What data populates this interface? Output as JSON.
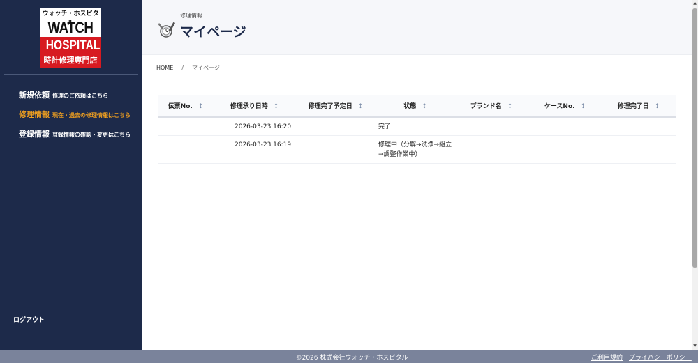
{
  "brand": {
    "logo_top": "ウォッチ・ホスピタル",
    "logo_watch": "WATCH",
    "logo_hospital": "HOSPITAL",
    "logo_bottom": "時計修理専門店"
  },
  "sidebar": {
    "items": [
      {
        "label": "新規依頼",
        "sub": "修理のご依頼はこちら",
        "active": false
      },
      {
        "label": "修理情報",
        "sub": "現在・過去の修理情報はこちら",
        "active": true
      },
      {
        "label": "登録情報",
        "sub": "登録情報の確認・変更はこちら",
        "active": false
      }
    ],
    "logout": "ログアウト",
    "active_color": "#f0a020"
  },
  "header": {
    "subtitle": "修理情報",
    "title": "マイページ",
    "icon": "repair-tools-icon"
  },
  "breadcrumb": {
    "home": "HOME",
    "separator": "/",
    "current": "マイページ"
  },
  "table": {
    "sort_icon": "↕",
    "columns": [
      "伝票No.",
      "修理承り日時",
      "修理完了予定日",
      "状態",
      "ブランド名",
      "ケースNo.",
      "修理完了日"
    ],
    "rows": [
      {
        "slip_no": "",
        "received": "2026-03-23 16:20",
        "scheduled": "",
        "status": "完了",
        "brand": "",
        "case_no": "",
        "completed": ""
      },
      {
        "slip_no": "",
        "received": "2026-03-23 16:19",
        "scheduled": "",
        "status": "修理中（分解→洗浄→組立→調整作業中）",
        "brand": "",
        "case_no": "",
        "completed": ""
      }
    ]
  },
  "footer": {
    "copyright": "©2026 株式会社ウォッチ・ホスピタル",
    "links": [
      "ご利用規約",
      "プライバシーポリシー"
    ]
  },
  "colors": {
    "sidebar_bg": "#1d2a4a",
    "footer_bg": "#7a839b",
    "logo_red": "#d71a21"
  }
}
